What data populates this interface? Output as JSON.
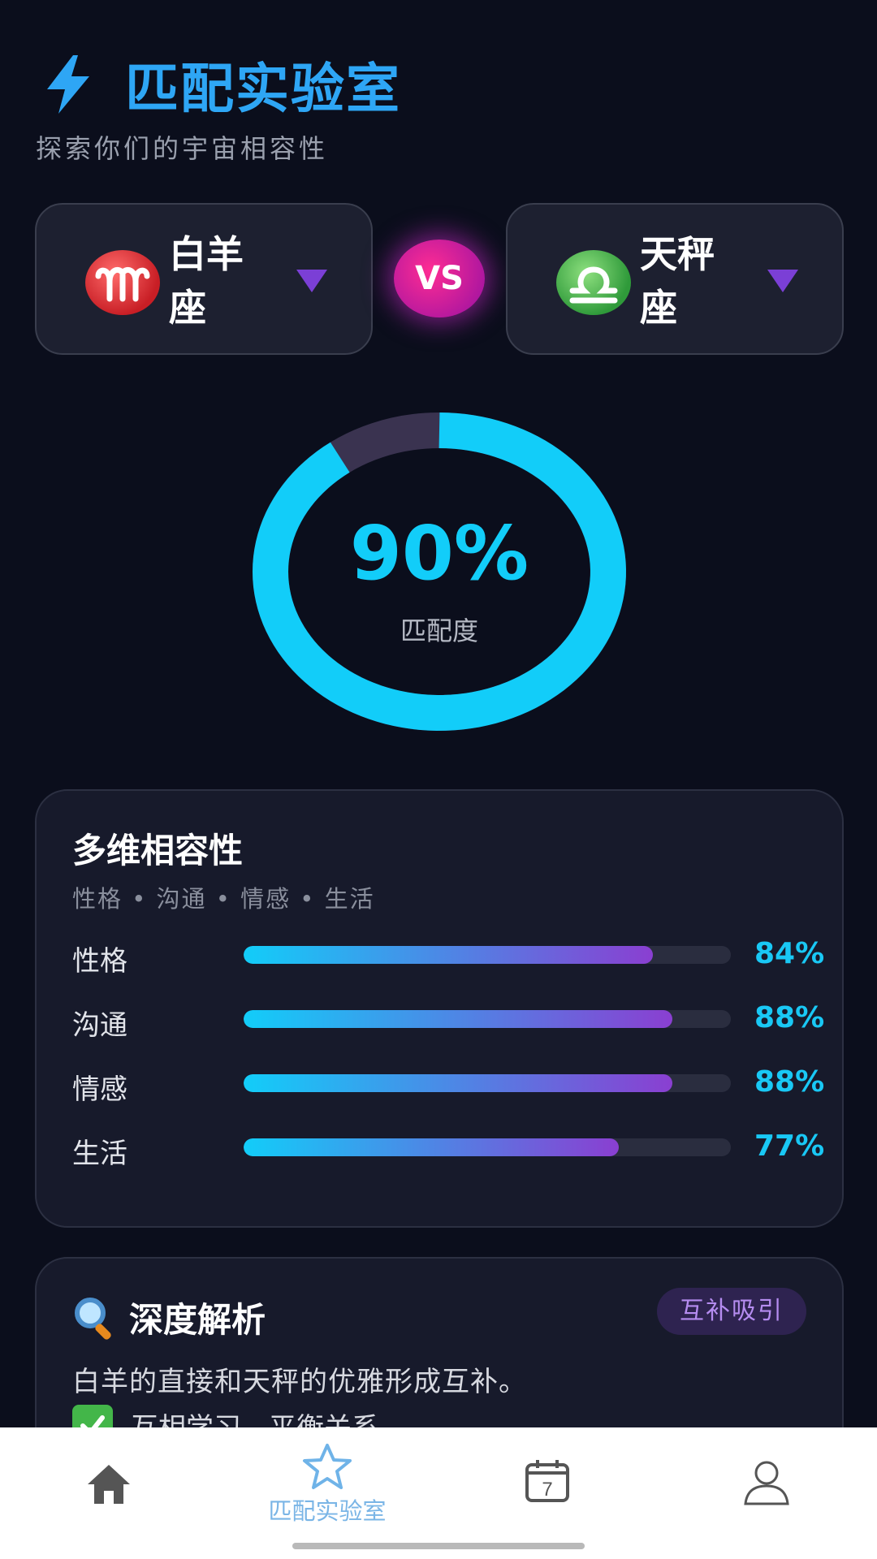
{
  "header": {
    "title": "匹配实验室",
    "subtitle": "探索你们的宇宙相容性",
    "icon": "lightning-bolt-icon"
  },
  "selectors": {
    "left": {
      "name": "白羊座",
      "symbol": "♈",
      "icon": "aries-icon",
      "color": "#d92b31"
    },
    "vs_label": "VS",
    "right": {
      "name": "天秤座",
      "symbol": "♎",
      "icon": "libra-icon",
      "color": "#3ea845"
    }
  },
  "match": {
    "percent_value": 90,
    "percent_label": "90%",
    "caption": "匹配度"
  },
  "dimensions": {
    "title": "多维相容性",
    "subtitle": "性格 • 沟通 • 情感 • 生活",
    "items": [
      {
        "label": "性格",
        "value": 84,
        "pct_label": "84%"
      },
      {
        "label": "沟通",
        "value": 88,
        "pct_label": "88%"
      },
      {
        "label": "情感",
        "value": 88,
        "pct_label": "88%"
      },
      {
        "label": "生活",
        "value": 77,
        "pct_label": "77%"
      }
    ]
  },
  "analysis": {
    "title": "深度解析",
    "tag": "互补吸引",
    "text": "白羊的直接和天秤的优雅形成互补。",
    "point": "互相学习，平衡关系"
  },
  "nav": {
    "items": [
      {
        "icon": "home-icon",
        "label": ""
      },
      {
        "icon": "star-icon",
        "label": "匹配实验室",
        "active": true
      },
      {
        "icon": "calendar-icon",
        "label": "",
        "day": "7"
      },
      {
        "icon": "profile-icon",
        "label": ""
      }
    ]
  },
  "colors": {
    "accent": "#12cdf9",
    "title": "#2ea6f5",
    "ring_remaining": "#3a3350",
    "vs": "#e0229a",
    "tag_bg": "#2e2350",
    "tag_text": "#b58cf0"
  }
}
